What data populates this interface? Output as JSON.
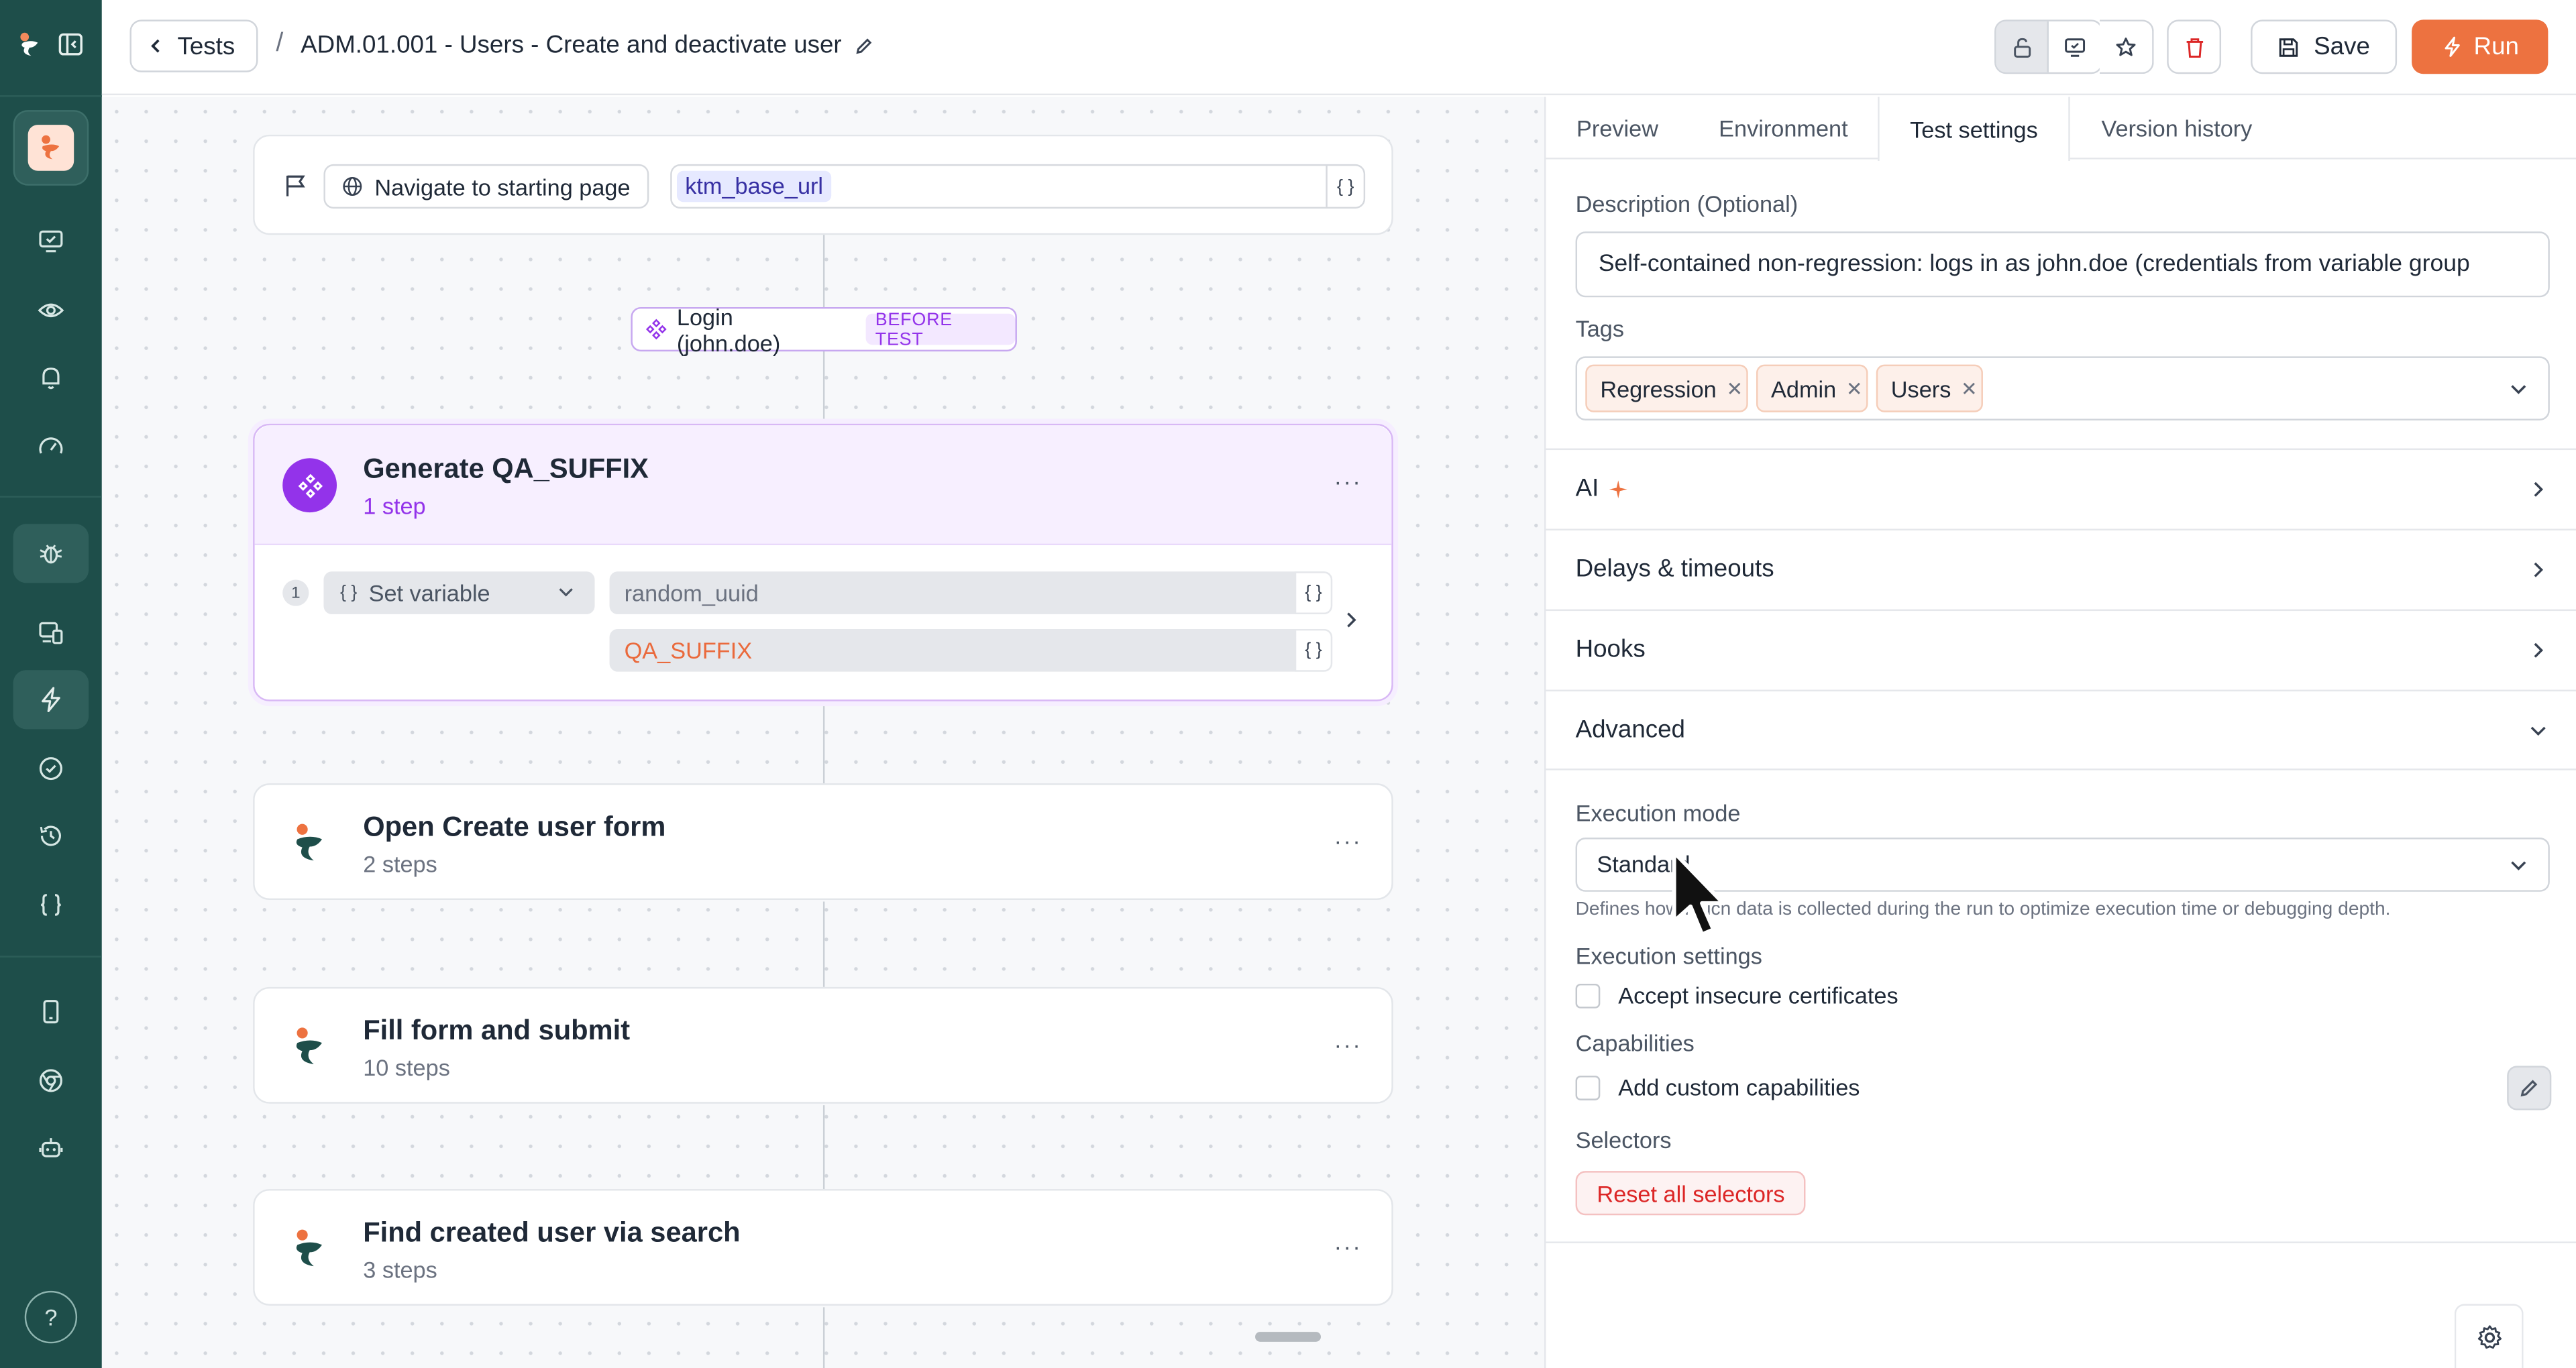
{
  "topbar": {
    "back_label": "Tests",
    "separator": "/",
    "title": "ADM.01.001 - Users - Create and deactivate user",
    "save_label": "Save",
    "run_label": "Run"
  },
  "canvas": {
    "navigate": {
      "label": "Navigate to starting page",
      "variable": "ktm_base_url",
      "brace": "{ }"
    },
    "hook": {
      "label": "Login (john.doe)",
      "tag": "BEFORE TEST"
    },
    "generate": {
      "title": "Generate QA_SUFFIX",
      "subtitle": "1 step",
      "step_number": "1",
      "action": "Set variable",
      "action_icon": "{ }",
      "field_1": "random_uuid",
      "field_2": "QA_SUFFIX",
      "brace": "{ }",
      "menu": "···"
    },
    "steps": [
      {
        "title": "Open Create user form",
        "subtitle": "2 steps",
        "menu": "···"
      },
      {
        "title": "Fill form and submit",
        "subtitle": "10 steps",
        "menu": "···"
      },
      {
        "title": "Find created user via search",
        "subtitle": "3 steps",
        "menu": "···"
      }
    ]
  },
  "panel": {
    "tabs": [
      "Preview",
      "Environment",
      "Test settings",
      "Version history"
    ],
    "active_tab": "Test settings",
    "description_label": "Description (Optional)",
    "description_value": "Self-contained non-regression: logs in as john.doe (credentials from variable group",
    "tags_label": "Tags",
    "tags": [
      "Regression",
      "Admin",
      "Users"
    ],
    "sections": {
      "ai": "AI",
      "delays": "Delays & timeouts",
      "hooks": "Hooks",
      "advanced": "Advanced"
    },
    "execution_mode_label": "Execution mode",
    "execution_mode_value": "Standard",
    "execution_mode_help": "Defines how much data is collected during the run to optimize execution time or debugging depth.",
    "execution_settings_label": "Execution settings",
    "accept_insecure_label": "Accept insecure certificates",
    "capabilities_label": "Capabilities",
    "custom_capabilities_label": "Add custom capabilities",
    "selectors_label": "Selectors",
    "reset_selectors_label": "Reset all selectors"
  },
  "sidebar": {
    "help_label": "?"
  },
  "colors": {
    "sidebar_bg": "#1e4e4a",
    "accent_orange": "#ed7240",
    "purple": "#9333ea",
    "danger": "#dc2626"
  }
}
